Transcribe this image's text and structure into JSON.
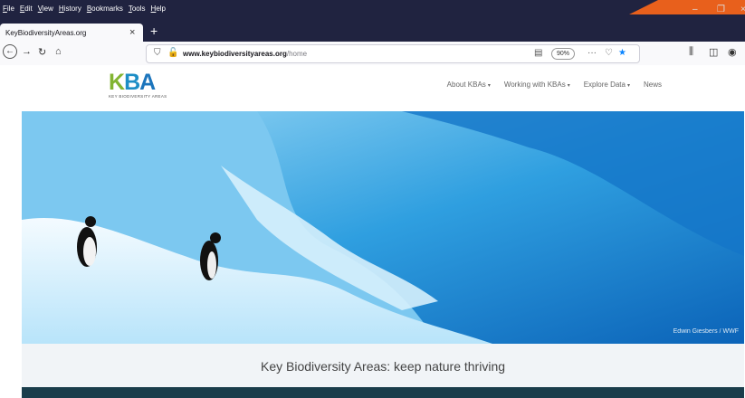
{
  "menu": [
    "File",
    "Edit",
    "View",
    "History",
    "Bookmarks",
    "Tools",
    "Help"
  ],
  "tab": {
    "title": "KeyBiodiversityAreas.org",
    "close": "×",
    "new": "+"
  },
  "toolbar": {
    "url_host": "www.keybiodiversityareas.org",
    "url_path": "/home",
    "zoom": "90%",
    "more": "···"
  },
  "site": {
    "logo_letters": [
      "K",
      "B",
      "A"
    ],
    "logo_sub": "KEY BIODIVERSITY AREAS",
    "nav": [
      {
        "label": "About KBAs",
        "dropdown": true
      },
      {
        "label": "Working with KBAs",
        "dropdown": true
      },
      {
        "label": "Explore Data",
        "dropdown": true
      },
      {
        "label": "News",
        "dropdown": false
      }
    ]
  },
  "hero": {
    "credit": "Edwin Giesbers / WWF"
  },
  "tagline": "Key Biodiversity Areas: keep nature thriving",
  "colors": {
    "chrome": "#202340",
    "accent": "#e8601c",
    "logo_green": "#82b431",
    "logo_blue": "#1d8ec6",
    "footer": "#1a3d4b"
  }
}
